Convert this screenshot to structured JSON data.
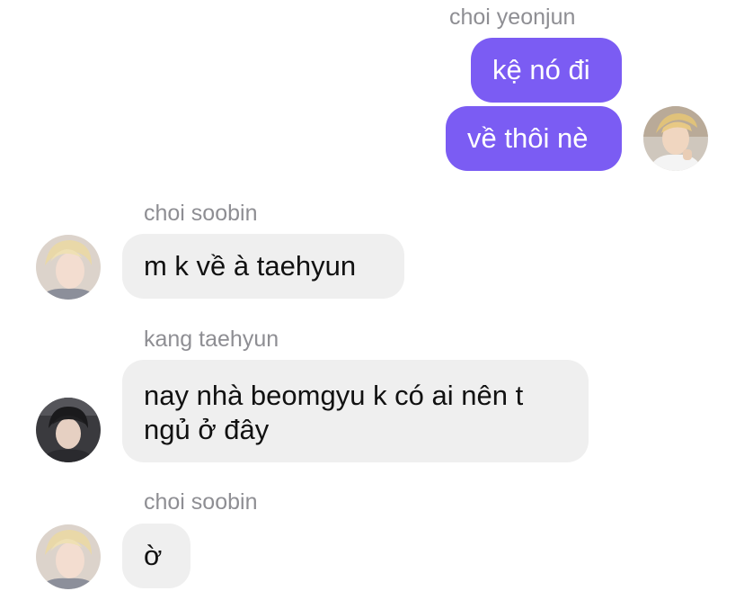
{
  "thread": [
    {
      "sender": "choi yeonjun",
      "direction": "outgoing",
      "messages": [
        "kệ nó đi",
        "về thôi nè"
      ],
      "avatar_icon": "user-avatar-photo-icon"
    },
    {
      "sender": "choi soobin",
      "direction": "incoming",
      "messages": [
        "m k về à taehyun"
      ],
      "avatar_icon": "user-avatar-photo-icon"
    },
    {
      "sender": "kang taehyun",
      "direction": "incoming",
      "messages": [
        "nay nhà beomgyu k có ai nên t",
        "ngủ ở đây"
      ],
      "avatar_icon": "user-avatar-photo-icon"
    },
    {
      "sender": "choi soobin",
      "direction": "incoming",
      "messages": [
        "ờ"
      ],
      "avatar_icon": "user-avatar-photo-icon"
    }
  ],
  "colors": {
    "outgoing_bubble": "#7b5cf3",
    "incoming_bubble": "#efefef",
    "sender_name": "#8e8e93"
  }
}
